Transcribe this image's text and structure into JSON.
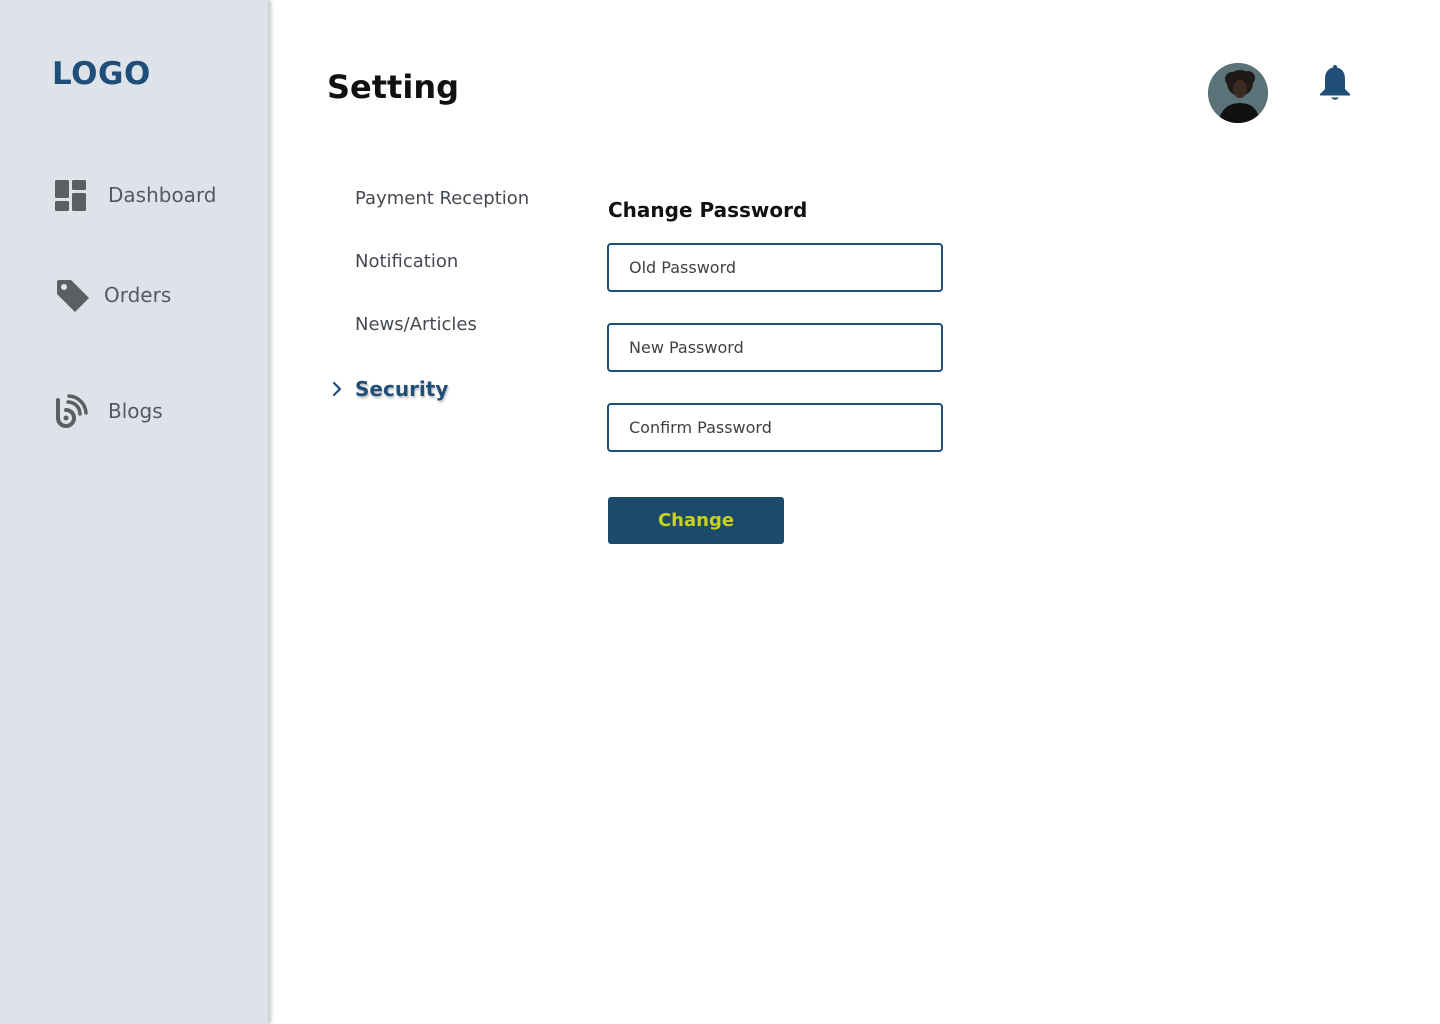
{
  "sidebar": {
    "logo": "LOGO",
    "items": [
      {
        "label": "Dashboard",
        "icon": "dashboard-icon"
      },
      {
        "label": "Orders",
        "icon": "tag-icon"
      },
      {
        "label": "Blogs",
        "icon": "blog-icon"
      }
    ]
  },
  "header": {
    "title": "Setting",
    "avatar_icon": "user-avatar",
    "notification_icon": "bell-icon"
  },
  "settings_menu": {
    "items": [
      {
        "label": "Payment Reception",
        "active": false
      },
      {
        "label": "Notification",
        "active": false
      },
      {
        "label": "News/Articles",
        "active": false
      },
      {
        "label": "Security",
        "active": true
      }
    ],
    "active_marker_icon": "chevron-right-icon"
  },
  "form": {
    "title": "Change Password",
    "fields": {
      "old_password": {
        "placeholder": "Old Password",
        "value": ""
      },
      "new_password": {
        "placeholder": "New Password",
        "value": ""
      },
      "confirm_password": {
        "placeholder": "Confirm Password",
        "value": ""
      }
    },
    "submit_label": "Change"
  },
  "colors": {
    "brand": "#1f4e79",
    "sidebar_bg": "#dde3e9",
    "button_bg": "#1b4a6b",
    "button_text": "#c9d219"
  }
}
